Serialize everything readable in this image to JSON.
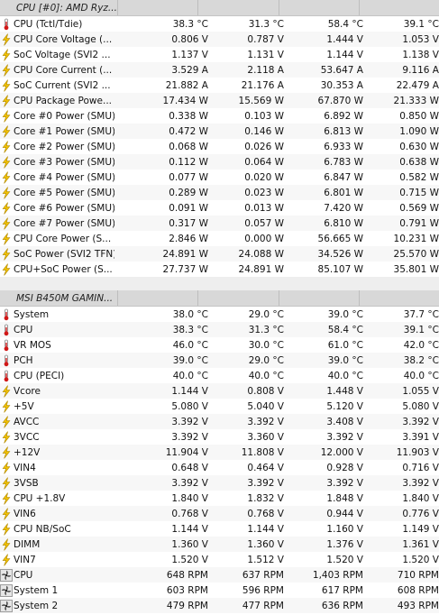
{
  "groups": [
    {
      "title": "CPU [#0]: AMD Ryz...",
      "rows": [
        {
          "icon": "thermometer-icon",
          "label": "CPU (Tctl/Tdie)",
          "v": [
            "38.3 °C",
            "31.3 °C",
            "58.4 °C",
            "39.1 °C"
          ]
        },
        {
          "icon": "voltage-bolt-icon",
          "label": "CPU Core Voltage (...",
          "v": [
            "0.806 V",
            "0.787 V",
            "1.444 V",
            "1.053 V"
          ]
        },
        {
          "icon": "voltage-bolt-icon",
          "label": "SoC Voltage (SVI2 ...",
          "v": [
            "1.137 V",
            "1.131 V",
            "1.144 V",
            "1.138 V"
          ]
        },
        {
          "icon": "voltage-bolt-icon",
          "label": "CPU Core Current (...",
          "v": [
            "3.529 A",
            "2.118 A",
            "53.647 A",
            "9.116 A"
          ]
        },
        {
          "icon": "voltage-bolt-icon",
          "label": "SoC Current (SVI2 ...",
          "v": [
            "21.882 A",
            "21.176 A",
            "30.353 A",
            "22.479 A"
          ]
        },
        {
          "icon": "voltage-bolt-icon",
          "label": "CPU Package Powe...",
          "v": [
            "17.434 W",
            "15.569 W",
            "67.870 W",
            "21.333 W"
          ]
        },
        {
          "icon": "voltage-bolt-icon",
          "label": "Core #0 Power (SMU)",
          "v": [
            "0.338 W",
            "0.103 W",
            "6.892 W",
            "0.850 W"
          ]
        },
        {
          "icon": "voltage-bolt-icon",
          "label": "Core #1 Power (SMU)",
          "v": [
            "0.472 W",
            "0.146 W",
            "6.813 W",
            "1.090 W"
          ]
        },
        {
          "icon": "voltage-bolt-icon",
          "label": "Core #2 Power (SMU)",
          "v": [
            "0.068 W",
            "0.026 W",
            "6.933 W",
            "0.630 W"
          ]
        },
        {
          "icon": "voltage-bolt-icon",
          "label": "Core #3 Power (SMU)",
          "v": [
            "0.112 W",
            "0.064 W",
            "6.783 W",
            "0.638 W"
          ]
        },
        {
          "icon": "voltage-bolt-icon",
          "label": "Core #4 Power (SMU)",
          "v": [
            "0.077 W",
            "0.020 W",
            "6.847 W",
            "0.582 W"
          ]
        },
        {
          "icon": "voltage-bolt-icon",
          "label": "Core #5 Power (SMU)",
          "v": [
            "0.289 W",
            "0.023 W",
            "6.801 W",
            "0.715 W"
          ]
        },
        {
          "icon": "voltage-bolt-icon",
          "label": "Core #6 Power (SMU)",
          "v": [
            "0.091 W",
            "0.013 W",
            "7.420 W",
            "0.569 W"
          ]
        },
        {
          "icon": "voltage-bolt-icon",
          "label": "Core #7 Power (SMU)",
          "v": [
            "0.317 W",
            "0.057 W",
            "6.810 W",
            "0.791 W"
          ]
        },
        {
          "icon": "voltage-bolt-icon",
          "label": "CPU Core Power (S...",
          "v": [
            "2.846 W",
            "0.000 W",
            "56.665 W",
            "10.231 W"
          ]
        },
        {
          "icon": "voltage-bolt-icon",
          "label": "SoC Power (SVI2 TFN)",
          "v": [
            "24.891 W",
            "24.088 W",
            "34.526 W",
            "25.570 W"
          ]
        },
        {
          "icon": "voltage-bolt-icon",
          "label": "CPU+SoC Power (S...",
          "v": [
            "27.737 W",
            "24.891 W",
            "85.107 W",
            "35.801 W"
          ]
        }
      ]
    },
    {
      "title": "MSI B450M GAMIN...",
      "rows": [
        {
          "icon": "thermometer-icon",
          "label": "System",
          "v": [
            "38.0 °C",
            "29.0 °C",
            "39.0 °C",
            "37.7 °C"
          ]
        },
        {
          "icon": "thermometer-icon",
          "label": "CPU",
          "v": [
            "38.3 °C",
            "31.3 °C",
            "58.4 °C",
            "39.1 °C"
          ]
        },
        {
          "icon": "thermometer-icon",
          "label": "VR MOS",
          "v": [
            "46.0 °C",
            "30.0 °C",
            "61.0 °C",
            "42.0 °C"
          ]
        },
        {
          "icon": "thermometer-icon",
          "label": "PCH",
          "v": [
            "39.0 °C",
            "29.0 °C",
            "39.0 °C",
            "38.2 °C"
          ]
        },
        {
          "icon": "thermometer-icon",
          "label": "CPU (PECI)",
          "v": [
            "40.0 °C",
            "40.0 °C",
            "40.0 °C",
            "40.0 °C"
          ]
        },
        {
          "icon": "voltage-bolt-icon",
          "label": "Vcore",
          "v": [
            "1.144 V",
            "0.808 V",
            "1.448 V",
            "1.055 V"
          ]
        },
        {
          "icon": "voltage-bolt-icon",
          "label": "+5V",
          "v": [
            "5.080 V",
            "5.040 V",
            "5.120 V",
            "5.080 V"
          ]
        },
        {
          "icon": "voltage-bolt-icon",
          "label": "AVCC",
          "v": [
            "3.392 V",
            "3.392 V",
            "3.408 V",
            "3.392 V"
          ]
        },
        {
          "icon": "voltage-bolt-icon",
          "label": "3VCC",
          "v": [
            "3.392 V",
            "3.360 V",
            "3.392 V",
            "3.391 V"
          ]
        },
        {
          "icon": "voltage-bolt-icon",
          "label": "+12V",
          "v": [
            "11.904 V",
            "11.808 V",
            "12.000 V",
            "11.903 V"
          ]
        },
        {
          "icon": "voltage-bolt-icon",
          "label": "VIN4",
          "v": [
            "0.648 V",
            "0.464 V",
            "0.928 V",
            "0.716 V"
          ]
        },
        {
          "icon": "voltage-bolt-icon",
          "label": "3VSB",
          "v": [
            "3.392 V",
            "3.392 V",
            "3.392 V",
            "3.392 V"
          ]
        },
        {
          "icon": "voltage-bolt-icon",
          "label": "CPU +1.8V",
          "v": [
            "1.840 V",
            "1.832 V",
            "1.848 V",
            "1.840 V"
          ]
        },
        {
          "icon": "voltage-bolt-icon",
          "label": "VIN6",
          "v": [
            "0.768 V",
            "0.768 V",
            "0.944 V",
            "0.776 V"
          ]
        },
        {
          "icon": "voltage-bolt-icon",
          "label": "CPU NB/SoC",
          "v": [
            "1.144 V",
            "1.144 V",
            "1.160 V",
            "1.149 V"
          ]
        },
        {
          "icon": "voltage-bolt-icon",
          "label": "DIMM",
          "v": [
            "1.360 V",
            "1.360 V",
            "1.376 V",
            "1.361 V"
          ]
        },
        {
          "icon": "voltage-bolt-icon",
          "label": "VIN7",
          "v": [
            "1.520 V",
            "1.512 V",
            "1.520 V",
            "1.520 V"
          ]
        },
        {
          "icon": "fan-icon",
          "label": "CPU",
          "v": [
            "648 RPM",
            "637 RPM",
            "1,403 RPM",
            "710 RPM"
          ]
        },
        {
          "icon": "fan-icon",
          "label": "System 1",
          "v": [
            "603 RPM",
            "596 RPM",
            "617 RPM",
            "608 RPM"
          ]
        },
        {
          "icon": "fan-icon",
          "label": "System 2",
          "v": [
            "479 RPM",
            "477 RPM",
            "636 RPM",
            "493 RPM"
          ]
        }
      ]
    }
  ],
  "colors": {
    "thermometer": "#d01818",
    "bolt": "#f2c200",
    "bolt_stroke": "#b08800",
    "fan": "#5c5c5c"
  }
}
